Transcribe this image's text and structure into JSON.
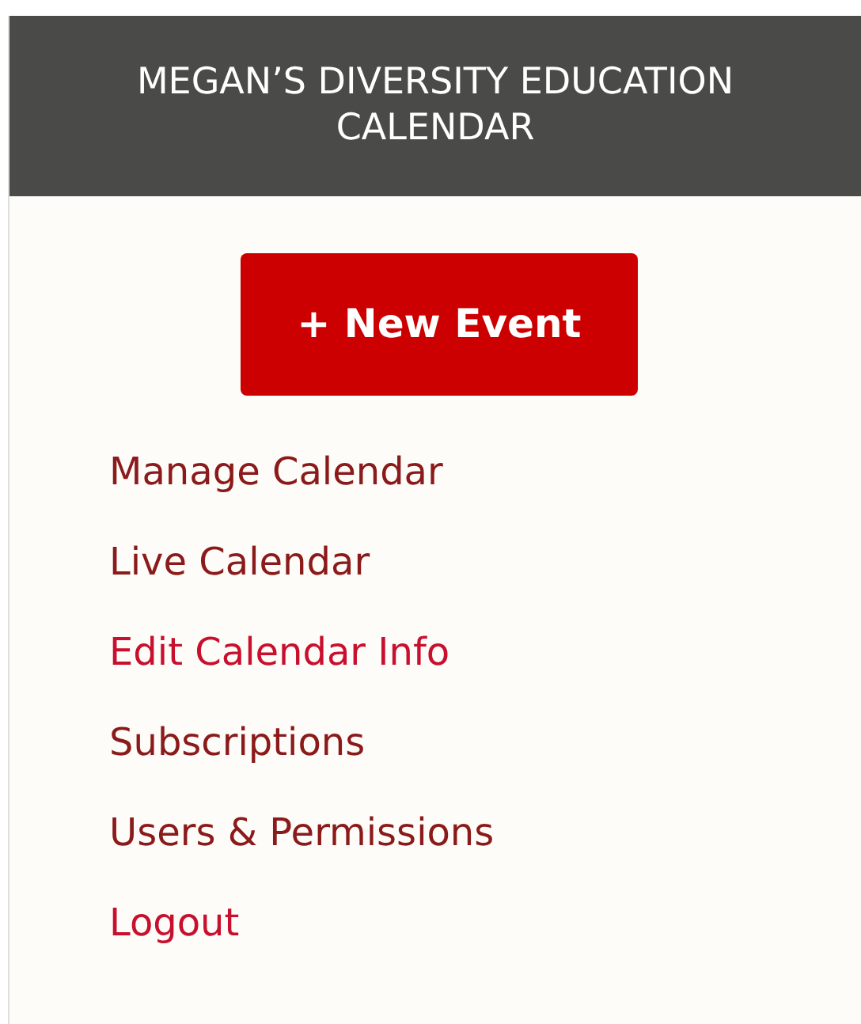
{
  "header": {
    "title": "MEGAN’S DIVERSITY EDUCATION CALENDAR"
  },
  "new_event_button": {
    "label": "+ New Event"
  },
  "menu": [
    {
      "label": "Manage Calendar",
      "color": "#8b1a1a"
    },
    {
      "label": "Live Calendar",
      "color": "#8b1a1a"
    },
    {
      "label": "Edit Calendar Info",
      "color": "#c8102e"
    },
    {
      "label": "Subscriptions",
      "color": "#8b1a1a"
    },
    {
      "label": "Users & Permissions",
      "color": "#8b1a1a"
    },
    {
      "label": "Logout",
      "color": "#c8102e"
    }
  ]
}
